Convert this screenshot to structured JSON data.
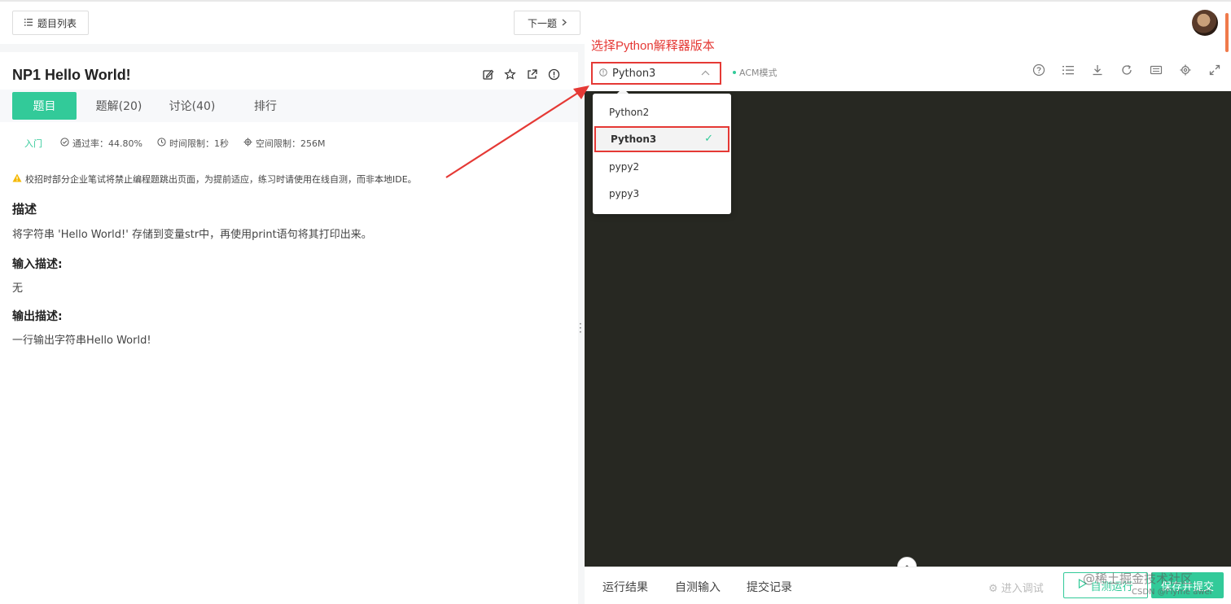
{
  "header": {
    "problem_list_label": "题目列表",
    "next_label": "下一题"
  },
  "problem": {
    "title": "NP1  Hello World!",
    "tabs": [
      {
        "label": "题目",
        "active": true
      },
      {
        "label": "题解(20)"
      },
      {
        "label": "讨论(40)"
      },
      {
        "label": "排行"
      }
    ],
    "level": "入门",
    "pass_rate": "通过率：44.80%",
    "time_limit": "时间限制：1秒",
    "space_limit": "空间限制：256M",
    "warning": "校招时部分企业笔试将禁止编程题跳出页面，为提前适应，练习时请使用在线自测，而非本地IDE。",
    "desc_heading": "描述",
    "desc_text": "将字符串 'Hello World!' 存储到变量str中，再使用print语句将其打印出来。",
    "input_heading": "输入描述:",
    "input_text": "无",
    "output_heading": "输出描述:",
    "output_text": "一行输出字符串Hello World!"
  },
  "editor": {
    "annotation": "选择Python解释器版本",
    "selected_language": "Python3",
    "mode_label": "ACM模式",
    "languages": [
      {
        "label": "Python2"
      },
      {
        "label": "Python3",
        "selected": true
      },
      {
        "label": "pypy2"
      },
      {
        "label": "pypy3"
      }
    ],
    "toolbar_icons": [
      "help-icon",
      "list-icon",
      "download-icon",
      "refresh-icon",
      "keyboard-icon",
      "settings-icon",
      "fullscreen-icon"
    ]
  },
  "bottom": {
    "tabs": [
      "运行结果",
      "自测输入",
      "提交记录"
    ],
    "debug_label": "进入调试",
    "run_label": "自测运行",
    "submit_label": "保存并提交"
  },
  "watermark": {
    "main": "@稀土掘金技术社区",
    "sub": "CSDN @Flyme awei"
  },
  "colors": {
    "accent": "#32ca99",
    "annotation_red": "#e53935",
    "editor_bg": "#272822"
  }
}
